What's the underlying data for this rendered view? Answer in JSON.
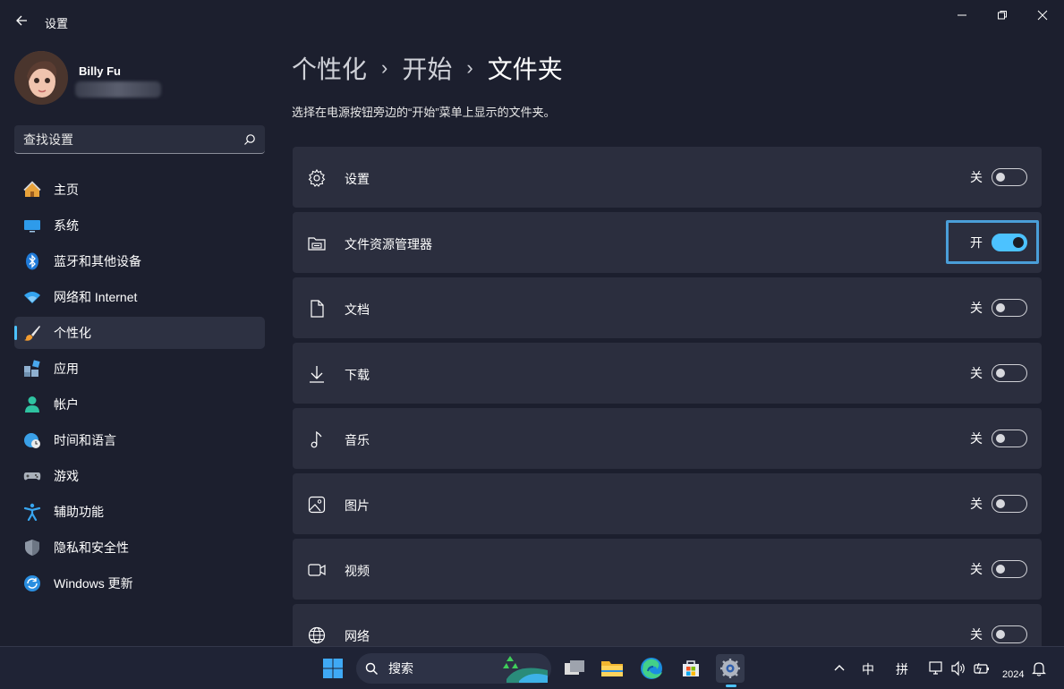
{
  "window": {
    "title": "设置",
    "controls": [
      "minimize",
      "restore",
      "close"
    ]
  },
  "user": {
    "name": "Billy Fu"
  },
  "search": {
    "placeholder": "查找设置"
  },
  "sidebar": {
    "items": [
      {
        "label": "主页",
        "icon": "home-icon"
      },
      {
        "label": "系统",
        "icon": "monitor-icon"
      },
      {
        "label": "蓝牙和其他设备",
        "icon": "bluetooth-icon"
      },
      {
        "label": "网络和 Internet",
        "icon": "wifi-icon"
      },
      {
        "label": "个性化",
        "icon": "brush-icon",
        "active": true
      },
      {
        "label": "应用",
        "icon": "apps-icon"
      },
      {
        "label": "帐户",
        "icon": "person-icon"
      },
      {
        "label": "时间和语言",
        "icon": "clock-globe-icon"
      },
      {
        "label": "游戏",
        "icon": "gamepad-icon"
      },
      {
        "label": "辅助功能",
        "icon": "accessibility-icon"
      },
      {
        "label": "隐私和安全性",
        "icon": "shield-icon"
      },
      {
        "label": "Windows 更新",
        "icon": "update-icon"
      }
    ]
  },
  "breadcrumb": {
    "parts": [
      "个性化",
      "开始"
    ],
    "current": "文件夹",
    "separator": "›"
  },
  "subtitle": "选择在电源按钮旁边的“开始”菜单上显示的文件夹。",
  "folders": [
    {
      "label": "设置",
      "icon": "gear-icon",
      "state": "关",
      "on": false
    },
    {
      "label": "文件资源管理器",
      "icon": "file-explorer-icon",
      "state": "开",
      "on": true,
      "focused": true
    },
    {
      "label": "文档",
      "icon": "document-icon",
      "state": "关",
      "on": false
    },
    {
      "label": "下载",
      "icon": "download-icon",
      "state": "关",
      "on": false
    },
    {
      "label": "音乐",
      "icon": "music-icon",
      "state": "关",
      "on": false
    },
    {
      "label": "图片",
      "icon": "picture-icon",
      "state": "关",
      "on": false
    },
    {
      "label": "视频",
      "icon": "video-icon",
      "state": "关",
      "on": false
    },
    {
      "label": "网络",
      "icon": "network-globe-icon",
      "state": "关",
      "on": false
    }
  ],
  "taskbar": {
    "search_label": "搜索",
    "tray": {
      "ime_lang": "中",
      "ime_mode": "拼",
      "year": "2024"
    }
  },
  "colors": {
    "accent": "#4cc2ff",
    "window_bg": "#1c1f2e",
    "card_bg": "#2b2e3e",
    "focus": "#4a9ed8"
  }
}
